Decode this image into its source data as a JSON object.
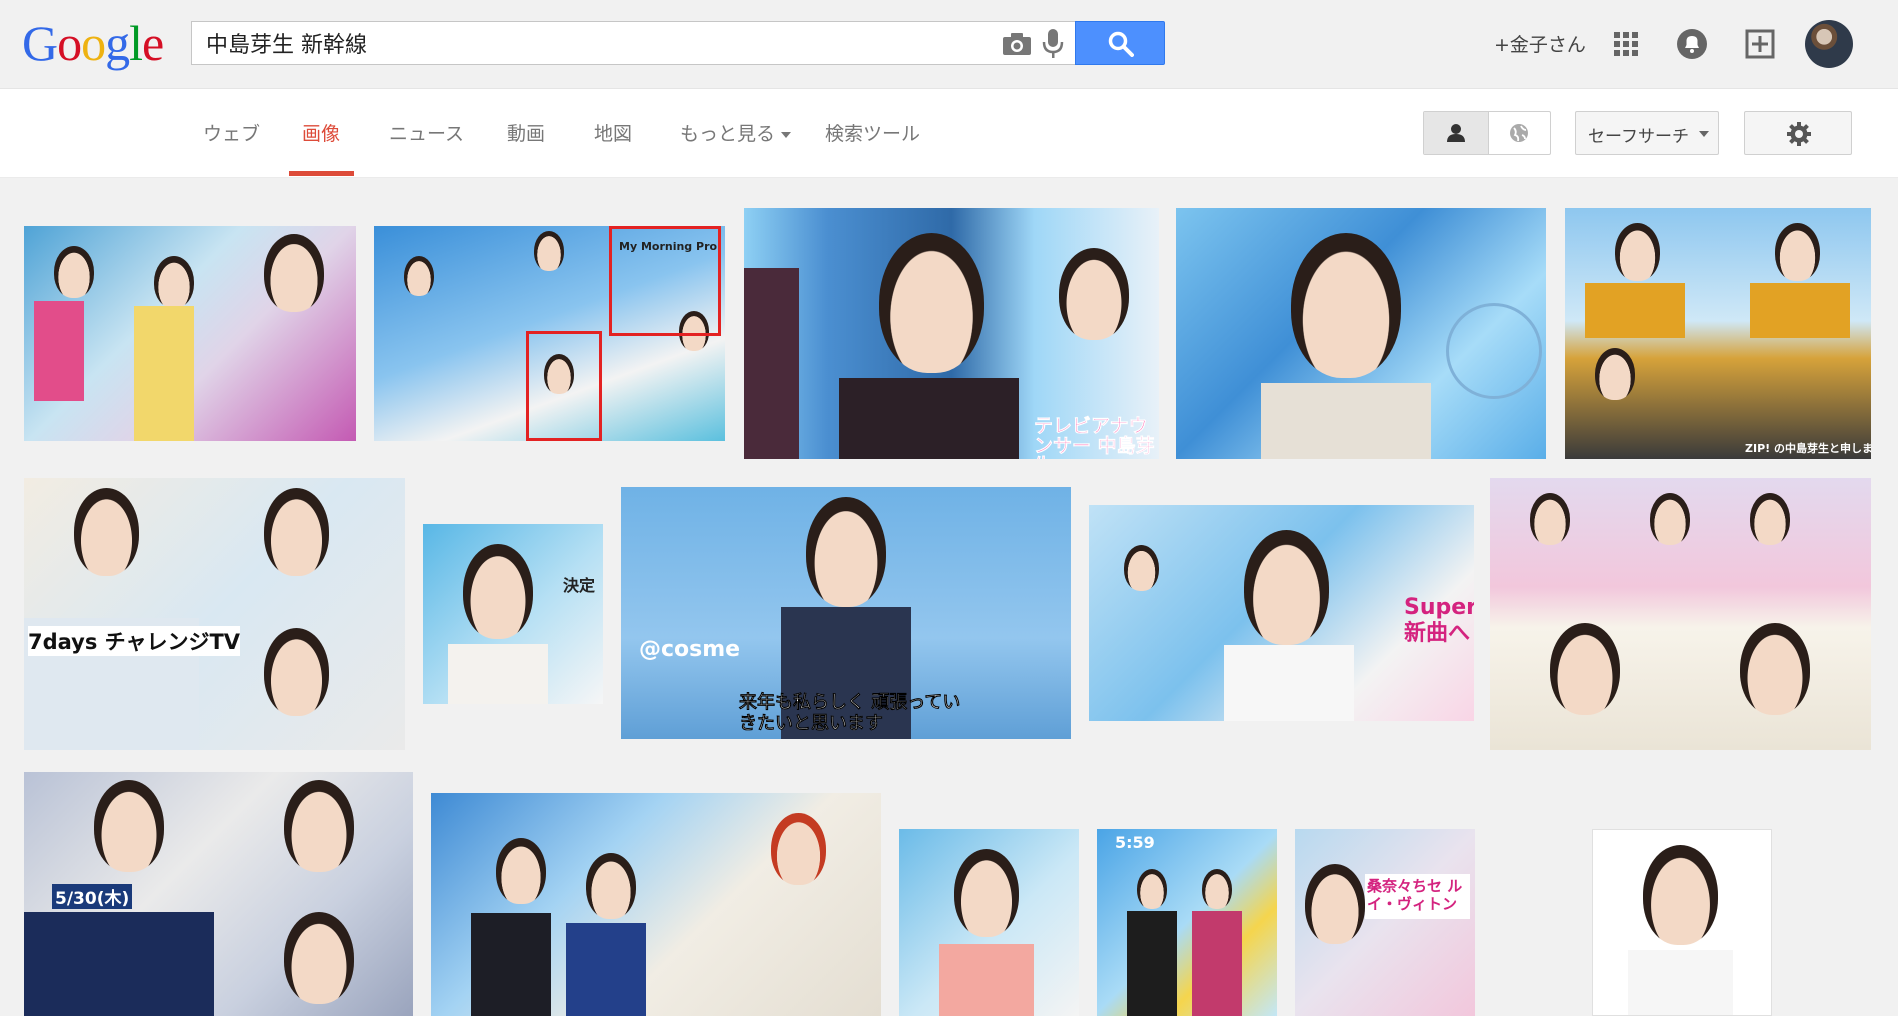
{
  "header": {
    "logo_letters": [
      {
        "ch": "G",
        "color": "#3369e8"
      },
      {
        "ch": "o",
        "color": "#d50f25"
      },
      {
        "ch": "o",
        "color": "#eeb211"
      },
      {
        "ch": "g",
        "color": "#3369e8"
      },
      {
        "ch": "l",
        "color": "#009925"
      },
      {
        "ch": "e",
        "color": "#d50f25"
      }
    ],
    "search": {
      "value": "中島芽生 新幹線",
      "placeholder": ""
    },
    "user_name": "+金子さん",
    "icons": [
      "camera-icon",
      "mic-icon",
      "search-icon",
      "apps-grid-icon",
      "notifications-bell-icon",
      "share-plus-icon",
      "avatar"
    ]
  },
  "nav": {
    "tabs": [
      {
        "label": "ウェブ",
        "active": false
      },
      {
        "label": "画像",
        "active": true
      },
      {
        "label": "ニュース",
        "active": false
      },
      {
        "label": "動画",
        "active": false
      },
      {
        "label": "地図",
        "active": false
      },
      {
        "label": "もっと見る",
        "active": false,
        "dropdown": true
      },
      {
        "label": "検索ツール",
        "active": false
      }
    ],
    "safesearch_label": "セーフサーチ",
    "accent_color": "#dd4b39"
  },
  "results": {
    "thumbnails": [
      {
        "caption": ""
      },
      {
        "caption": "My Morning Pro"
      },
      {
        "caption": "テレビアナウンサー 中島芽生"
      },
      {
        "caption": ""
      },
      {
        "caption": "ZIP! の中島芽生と申しま"
      },
      {
        "caption": "7days チャレンジTV"
      },
      {
        "caption": "決定"
      },
      {
        "caption": "来年も私らしく 頑張っていきたいと思います"
      },
      {
        "caption": "Super 新曲へ"
      },
      {
        "caption": ""
      },
      {
        "caption": "5/30(木)"
      },
      {
        "caption": ""
      },
      {
        "caption": ""
      },
      {
        "caption": "5:59"
      },
      {
        "caption": "桑奈々ちセ ルイ・ヴィトン"
      },
      {
        "caption": ""
      }
    ]
  }
}
